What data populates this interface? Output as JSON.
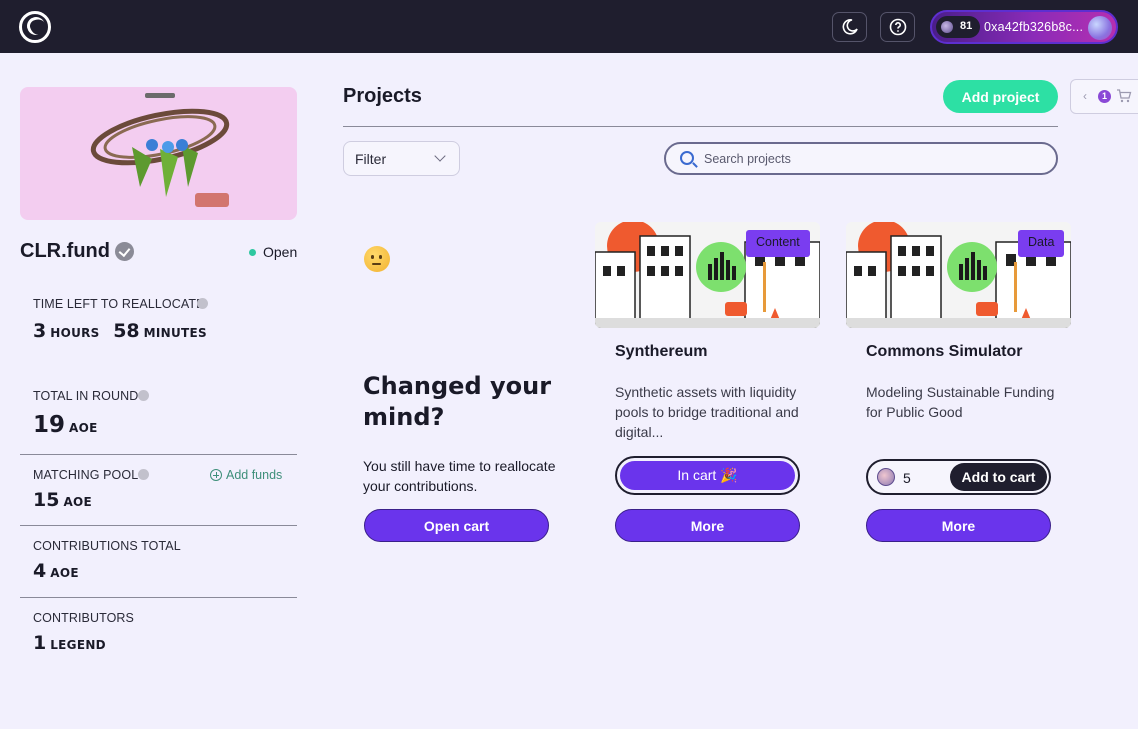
{
  "colors": {
    "accent": "#6a34ec",
    "success": "#2de0a4",
    "nav_bg": "#1f1e2e",
    "page_bg": "#f2f0fd"
  },
  "nav": {
    "logo_icon": "clrfund-logo-icon",
    "theme_icon": "moon-icon",
    "help_icon": "question-icon",
    "wallet": {
      "balance": "81",
      "address": "0xa42fb326b8c..."
    }
  },
  "round": {
    "title": "CLR.fund",
    "status": "Open",
    "time_left_label": "TIME LEFT TO REALLOCATE",
    "hours": "3",
    "hours_unit": "HOURS",
    "minutes": "58",
    "minutes_unit": "MINUTES",
    "total_label": "TOTAL IN ROUND",
    "total_value": "19",
    "total_unit": "AOE",
    "matching_label": "MATCHING POOL",
    "matching_value": "15",
    "matching_unit": "AOE",
    "add_funds": "Add funds",
    "contrib_total_label": "CONTRIBUTIONS TOTAL",
    "contrib_total_value": "4",
    "contrib_total_unit": "AOE",
    "contributors_label": "CONTRIBUTORS",
    "contributors_value": "1",
    "contributors_unit": "LEGEND"
  },
  "main": {
    "title": "Projects",
    "add_project": "Add project",
    "cart_count": "1",
    "filter_label": "Filter",
    "search_placeholder": "Search projects"
  },
  "reallocate": {
    "title": "Changed your mind?",
    "text": "You still have time to reallocate your contributions.",
    "button": "Open cart"
  },
  "projects": [
    {
      "tag": "Content",
      "name": "Synthereum",
      "description": "Synthetic assets with liquidity pools to bridge traditional and digital...",
      "cart_label": "In cart 🎉",
      "more": "More"
    },
    {
      "tag": "Data",
      "name": "Commons Simulator",
      "description": "Modeling Sustainable Funding for Public Good",
      "amount": "5",
      "add_label": "Add to cart",
      "more": "More"
    }
  ]
}
